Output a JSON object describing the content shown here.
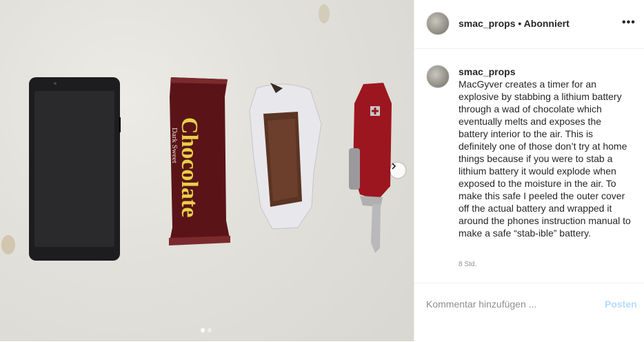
{
  "post": {
    "username": "smac_props",
    "separator": "•",
    "follow_status": "Abonniert",
    "more_label": "•••",
    "caption": "MacGyver creates a timer for an explosive by stabbing a lithium battery through a wad of chocolate which eventually melts and exposes the battery interior to the air. This is definitely one of those don’t try at home things because if you were to stab a lithium battery it would explode when exposed to the moisture in the air. To make this safe I peeled the outer cover off the actual battery and wrapped it around the phones instruction manual to make a safe “stab-ible” battery.",
    "time": "8 Std."
  },
  "comment_box": {
    "placeholder": "Kommentar hinzufügen ...",
    "post_label": "Posten"
  },
  "photo": {
    "candy_text": "Chocolate",
    "candy_sub": "Dark Sweet",
    "carousel_total": 2,
    "carousel_active": 1
  },
  "colors": {
    "post_button": "#b3dbff",
    "wrapper": "#5a1418",
    "candy_text": "#e8d04a"
  }
}
